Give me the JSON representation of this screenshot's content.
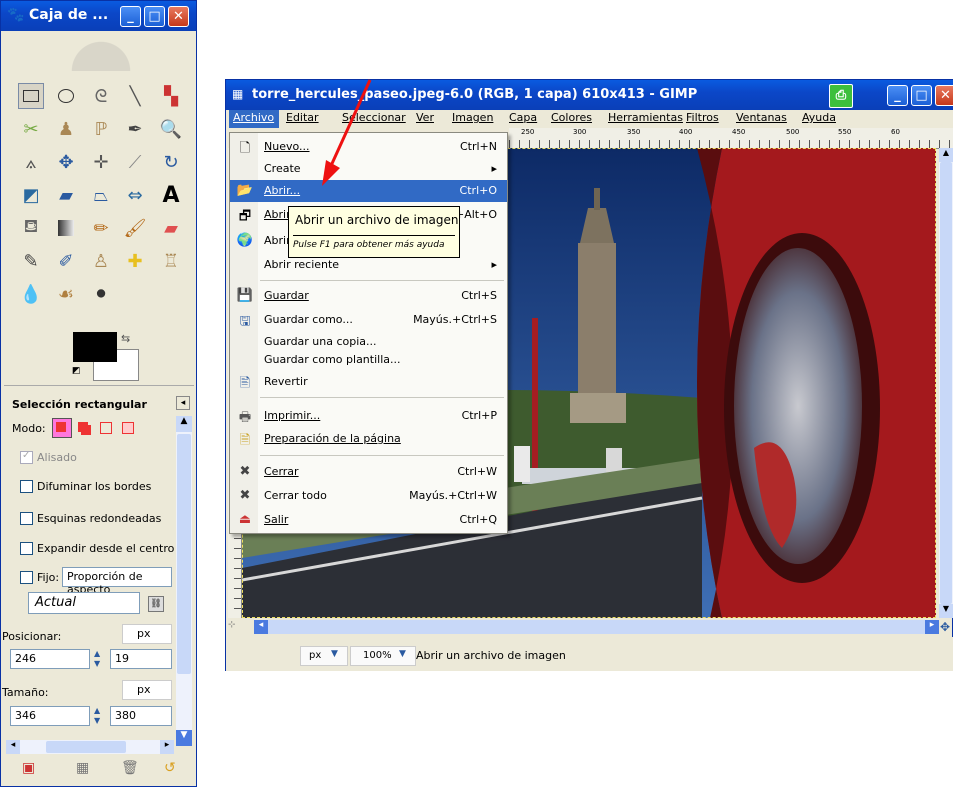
{
  "toolbox": {
    "title": "Caja de ...",
    "options_title": "Selección rectangular",
    "mode_label": "Modo:",
    "antialias_label": "Alisado",
    "feather_label": "Difuminar los bordes",
    "rounded_label": "Esquinas redondeadas",
    "expand_label": "Expandir desde el centro",
    "fixed_label": "Fijo:",
    "fixed_value": "Proporción de aspecto",
    "current_value": "Actual",
    "position_label": "Posicionar:",
    "position_unit": "px",
    "position_x": "246",
    "position_y": "19",
    "size_label": "Tamaño:",
    "size_unit": "px",
    "size_w": "346",
    "size_h": "380"
  },
  "gimp": {
    "title": "torre_hercules_paseo.jpeg-6.0 (RGB, 1 capa) 610x413 - GIMP",
    "menubar": [
      "Archivo",
      "Editar",
      "Seleccionar",
      "Ver",
      "Imagen",
      "Capa",
      "Colores",
      "Herramientas",
      "Filtros",
      "Ventanas",
      "Ayuda"
    ],
    "ruler_ticks": [
      "250",
      "300",
      "350",
      "400",
      "450",
      "500",
      "550",
      "60"
    ],
    "status_unit": "px",
    "zoom": "100%",
    "status_text": "Abrir un archivo de imagen"
  },
  "file_menu": [
    {
      "label": "Nuevo...",
      "shortcut": "Ctrl+N",
      "icon": "new-file-icon"
    },
    {
      "label": "Create",
      "shortcut": "",
      "arrow": "▸",
      "icon": ""
    },
    {
      "label": "Abrir...",
      "shortcut": "Ctrl+O",
      "icon": "folder-open-icon"
    },
    {
      "label": "Abrir",
      "shortcut": "+Alt+O",
      "icon": "open-as-layers-icon"
    },
    {
      "label": "Abrir",
      "shortcut": "",
      "icon": "globe-icon"
    },
    {
      "label": "Abrir reciente",
      "shortcut": "",
      "arrow": "▸",
      "icon": ""
    },
    {
      "label": "Guardar",
      "shortcut": "Ctrl+S",
      "icon": "save-icon"
    },
    {
      "label": "Guardar como...",
      "shortcut": "Mayús.+Ctrl+S",
      "icon": "save-as-icon"
    },
    {
      "label": "Guardar una copia...",
      "shortcut": "",
      "icon": ""
    },
    {
      "label": "Guardar como plantilla...",
      "shortcut": "",
      "icon": ""
    },
    {
      "label": "Revertir",
      "shortcut": "",
      "icon": "revert-icon"
    },
    {
      "label": "Imprimir...",
      "shortcut": "Ctrl+P",
      "icon": "print-icon"
    },
    {
      "label": "Preparación de la página",
      "shortcut": "",
      "icon": "page-setup-icon"
    },
    {
      "label": "Cerrar",
      "shortcut": "Ctrl+W",
      "icon": "close-x-icon"
    },
    {
      "label": "Cerrar todo",
      "shortcut": "Mayús.+Ctrl+W",
      "icon": "close-all-icon"
    },
    {
      "label": "Salir",
      "shortcut": "Ctrl+Q",
      "icon": "quit-icon"
    }
  ],
  "tooltip": {
    "main": "Abrir un archivo de imagen",
    "hint": "Pulse F1 para obtener más ayuda"
  },
  "colors": {
    "xp_blue": "#0a4fd0",
    "menu_highlight": "#316ac5",
    "annotation_arrow": "#ee1111"
  }
}
